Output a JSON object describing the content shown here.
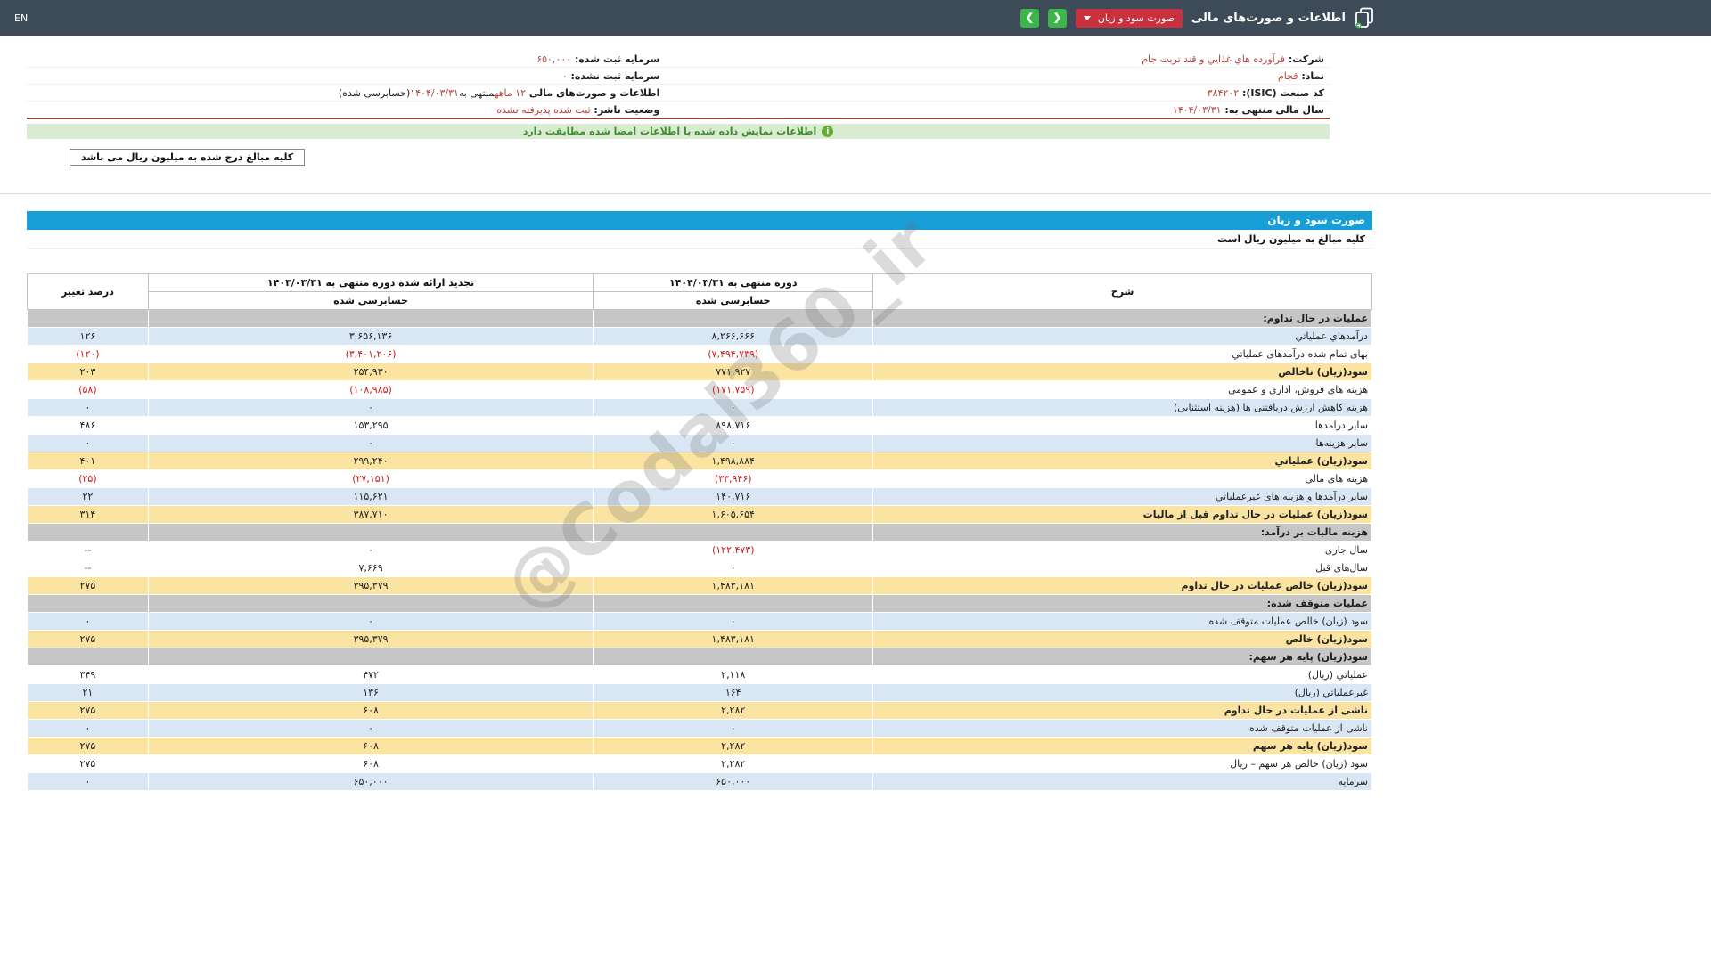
{
  "navbar": {
    "title": "اطلاعات و صورت‌های مالی",
    "dropdown_label": "صورت سود و زیان",
    "back_icon": "❮",
    "forward_icon": "❯",
    "lang_label": "EN"
  },
  "info": {
    "rows": [
      {
        "right": [
          {
            "t": "شرکت: ",
            "b": true
          },
          {
            "t": "فرآورده هاي غذايي و قند تربت جام",
            "r": true
          }
        ],
        "left": [
          {
            "t": "سرمایه ثبت شده: ",
            "b": true
          },
          {
            "t": "۶۵۰,۰۰۰",
            "r": true
          }
        ]
      },
      {
        "right": [
          {
            "t": "نماد: ",
            "b": true
          },
          {
            "t": "قجام",
            "r": true
          }
        ],
        "left": [
          {
            "t": "سرمایه ثبت نشده: ",
            "b": true
          },
          {
            "t": "۰",
            "r": true
          }
        ]
      },
      {
        "right": [
          {
            "t": "کد صنعت (ISIC): ",
            "b": true
          },
          {
            "t": "۳۸۴۲۰۲",
            "r": true
          }
        ],
        "left": [
          {
            "t": "اطلاعات و صورت‌های مالی ",
            "b": true
          },
          {
            "t": "۱۲ ماهه",
            "r": true
          },
          {
            "t": "منتهی به"
          },
          {
            "t": "۱۴۰۴/۰۳/۳۱",
            "r": true
          },
          {
            "t": "(حسابرسی شده)"
          }
        ]
      },
      {
        "right": [
          {
            "t": "سال مالی منتهی به: ",
            "b": true
          },
          {
            "t": "۱۴۰۴/۰۳/۳۱",
            "r": true
          }
        ],
        "left": [
          {
            "t": "وضعیت ناشر: ",
            "b": true
          },
          {
            "t": "ثبت شده پذیرفته نشده",
            "r": true
          }
        ]
      }
    ]
  },
  "banner": {
    "icon_glyph": "i",
    "text": "اطلاعات نمایش داده شده با اطلاعات امضا شده مطابقت دارد"
  },
  "notes": {
    "box": "کلیه مبالغ درج شده به میلیون ریال می باشد",
    "table_note": "کلیه مبالغ به میلیون ریال است"
  },
  "statement": {
    "title": "صورت سود و زیان",
    "headers": {
      "desc": "شرح",
      "period1": "دوره منتهی به ۱۴۰۴/۰۳/۳۱",
      "period2": "تجدید ارائه شده دوره منتهی به ۱۴۰۳/۰۳/۳۱",
      "change": "درصد تغییر",
      "audited": "حسابرسی شده"
    },
    "rows": [
      {
        "label": "عملیات در حال تداوم:",
        "variant": "section"
      },
      {
        "label": "درآمدهاي عملياتي",
        "v1": "۸,۲۶۶,۶۶۶",
        "v2": "۳,۶۵۶,۱۳۶",
        "pct": "۱۲۶",
        "variant": "blue"
      },
      {
        "label": "بهای تمام شده درآمدهای عملیاتي",
        "v1": "(۷,۴۹۴,۷۳۹)",
        "v2": "(۳,۴۰۱,۲۰۶)",
        "pct": "(۱۲۰)",
        "variant": "white"
      },
      {
        "label": "سود(زیان) ناخالص",
        "v1": "۷۷۱,۹۲۷",
        "v2": "۲۵۴,۹۳۰",
        "pct": "۲۰۳",
        "variant": "yellow"
      },
      {
        "label": "هزینه های فروش، اداری و عمومی",
        "v1": "(۱۷۱,۷۵۹)",
        "v2": "(۱۰۸,۹۸۵)",
        "pct": "(۵۸)",
        "variant": "white"
      },
      {
        "label": "هزینه کاهش ارزش دریافتنی ها (هزینه استثنایی)",
        "v1": "۰",
        "v2": "۰",
        "pct": "۰",
        "variant": "blue"
      },
      {
        "label": "سایر درآمدها",
        "v1": "۸۹۸,۷۱۶",
        "v2": "۱۵۳,۲۹۵",
        "pct": "۴۸۶",
        "variant": "white"
      },
      {
        "label": "سایر هزینه‌ها",
        "v1": "۰",
        "v2": "۰",
        "pct": "۰",
        "variant": "blue"
      },
      {
        "label": "سود(زیان) عملیاتي",
        "v1": "۱,۴۹۸,۸۸۴",
        "v2": "۲۹۹,۲۴۰",
        "pct": "۴۰۱",
        "variant": "yellow"
      },
      {
        "label": "هزینه های مالی",
        "v1": "(۳۳,۹۴۶)",
        "v2": "(۲۷,۱۵۱)",
        "pct": "(۲۵)",
        "variant": "white"
      },
      {
        "label": "سایر درآمدها و هزینه های غیرعملیاتي",
        "v1": "۱۴۰,۷۱۶",
        "v2": "۱۱۵,۶۲۱",
        "pct": "۲۲",
        "variant": "blue"
      },
      {
        "label": "سود(زیان) عملیات در حال تداوم قبل از مالیات",
        "v1": "۱,۶۰۵,۶۵۴",
        "v2": "۳۸۷,۷۱۰",
        "pct": "۳۱۴",
        "variant": "yellow"
      },
      {
        "label": "هزینه مالیات بر درآمد:",
        "variant": "section"
      },
      {
        "label": "سال جاری",
        "v1": "(۱۲۲,۴۷۳)",
        "v2": "۰",
        "pct": "--",
        "variant": "white"
      },
      {
        "label": "سال‌های قبل",
        "v1": "۰",
        "v2": "۷,۶۶۹",
        "pct": "--",
        "variant": "white"
      },
      {
        "label": "سود(زیان) خالص عملیات در حال تداوم",
        "v1": "۱,۴۸۳,۱۸۱",
        "v2": "۳۹۵,۳۷۹",
        "pct": "۲۷۵",
        "variant": "yellow"
      },
      {
        "label": "عملیات متوقف شده:",
        "variant": "section"
      },
      {
        "label": "سود (زیان) خالص عملیات متوقف شده",
        "v1": "۰",
        "v2": "۰",
        "pct": "۰",
        "variant": "blue"
      },
      {
        "label": "سود(زیان) خالص",
        "v1": "۱,۴۸۳,۱۸۱",
        "v2": "۳۹۵,۳۷۹",
        "pct": "۲۷۵",
        "variant": "yellow"
      },
      {
        "label": "سود(زیان) پایه هر سهم:",
        "variant": "section"
      },
      {
        "label": "عملیاتي (ریال)",
        "v1": "۲,۱۱۸",
        "v2": "۴۷۲",
        "pct": "۳۴۹",
        "variant": "white"
      },
      {
        "label": "غیرعملیاتي (ریال)",
        "v1": "۱۶۴",
        "v2": "۱۳۶",
        "pct": "۲۱",
        "variant": "blue"
      },
      {
        "label": "ناشی از عملیات در حال تداوم",
        "v1": "۲,۲۸۲",
        "v2": "۶۰۸",
        "pct": "۲۷۵",
        "variant": "yellow"
      },
      {
        "label": "ناشی از عملیات متوقف شده",
        "v1": "۰",
        "v2": "۰",
        "pct": "۰",
        "variant": "blue"
      },
      {
        "label": "سود(زیان) پایه هر سهم",
        "v1": "۲,۲۸۲",
        "v2": "۶۰۸",
        "pct": "۲۷۵",
        "variant": "yellow"
      },
      {
        "label": "سود (زیان) خالص هر سهم – ریال",
        "v1": "۲,۲۸۲",
        "v2": "۶۰۸",
        "pct": "۲۷۵",
        "variant": "white"
      },
      {
        "label": "سرمایه",
        "v1": "۶۵۰,۰۰۰",
        "v2": "۶۵۰,۰۰۰",
        "pct": "۰",
        "variant": "blue"
      }
    ]
  },
  "watermark": {
    "text": "@Codal360_ir"
  }
}
